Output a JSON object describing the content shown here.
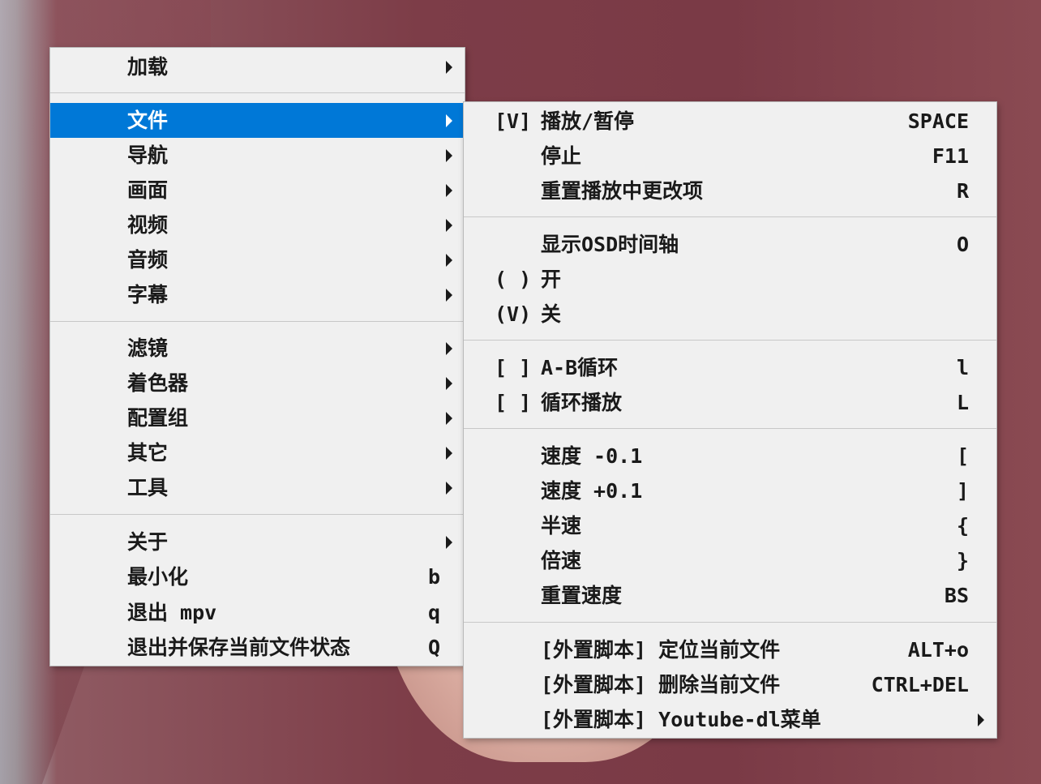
{
  "main_menu": {
    "items": [
      {
        "label": "加载",
        "submenu": true
      },
      {
        "label": "文件",
        "submenu": true,
        "highlighted": true
      },
      {
        "label": "导航",
        "submenu": true
      },
      {
        "label": "画面",
        "submenu": true
      },
      {
        "label": "视频",
        "submenu": true
      },
      {
        "label": "音频",
        "submenu": true
      },
      {
        "label": "字幕",
        "submenu": true
      },
      {
        "label": "滤镜",
        "submenu": true
      },
      {
        "label": "着色器",
        "submenu": true
      },
      {
        "label": "配置组",
        "submenu": true
      },
      {
        "label": "其它",
        "submenu": true
      },
      {
        "label": "工具",
        "submenu": true
      },
      {
        "label": "关于",
        "submenu": true
      },
      {
        "label": "最小化",
        "shortcut": "b"
      },
      {
        "label": "退出 mpv",
        "shortcut": "q"
      },
      {
        "label": "退出并保存当前文件状态",
        "shortcut": "Q"
      }
    ]
  },
  "file_submenu": {
    "items": [
      {
        "mark": "[V]",
        "label": "播放/暂停",
        "shortcut": "SPACE"
      },
      {
        "mark": "",
        "label": "停止",
        "shortcut": "F11"
      },
      {
        "mark": "",
        "label": "重置播放中更改项",
        "shortcut": "R"
      },
      {
        "mark": "",
        "label": "显示OSD时间轴",
        "shortcut": "O"
      },
      {
        "mark": "( )",
        "label": "开",
        "shortcut": ""
      },
      {
        "mark": "(V)",
        "label": "关",
        "shortcut": ""
      },
      {
        "mark": "[ ]",
        "label": "A-B循环",
        "shortcut": "l"
      },
      {
        "mark": "[ ]",
        "label": "循环播放",
        "shortcut": "L"
      },
      {
        "mark": "",
        "label": "速度 -0.1",
        "shortcut": "["
      },
      {
        "mark": "",
        "label": "速度 +0.1",
        "shortcut": "]"
      },
      {
        "mark": "",
        "label": "半速",
        "shortcut": "{"
      },
      {
        "mark": "",
        "label": "倍速",
        "shortcut": "}"
      },
      {
        "mark": "",
        "label": "重置速度",
        "shortcut": "BS"
      },
      {
        "mark": "",
        "label": "[外置脚本] 定位当前文件",
        "shortcut": "ALT+o"
      },
      {
        "mark": "",
        "label": "[外置脚本] 删除当前文件",
        "shortcut": "CTRL+DEL"
      },
      {
        "mark": "",
        "label": "[外置脚本] Youtube-dl菜单",
        "shortcut": "",
        "submenu": true
      }
    ]
  },
  "colors": {
    "menu_bg": "#f0f0f0",
    "highlight": "#0078d7",
    "text": "#1a1a1a"
  }
}
